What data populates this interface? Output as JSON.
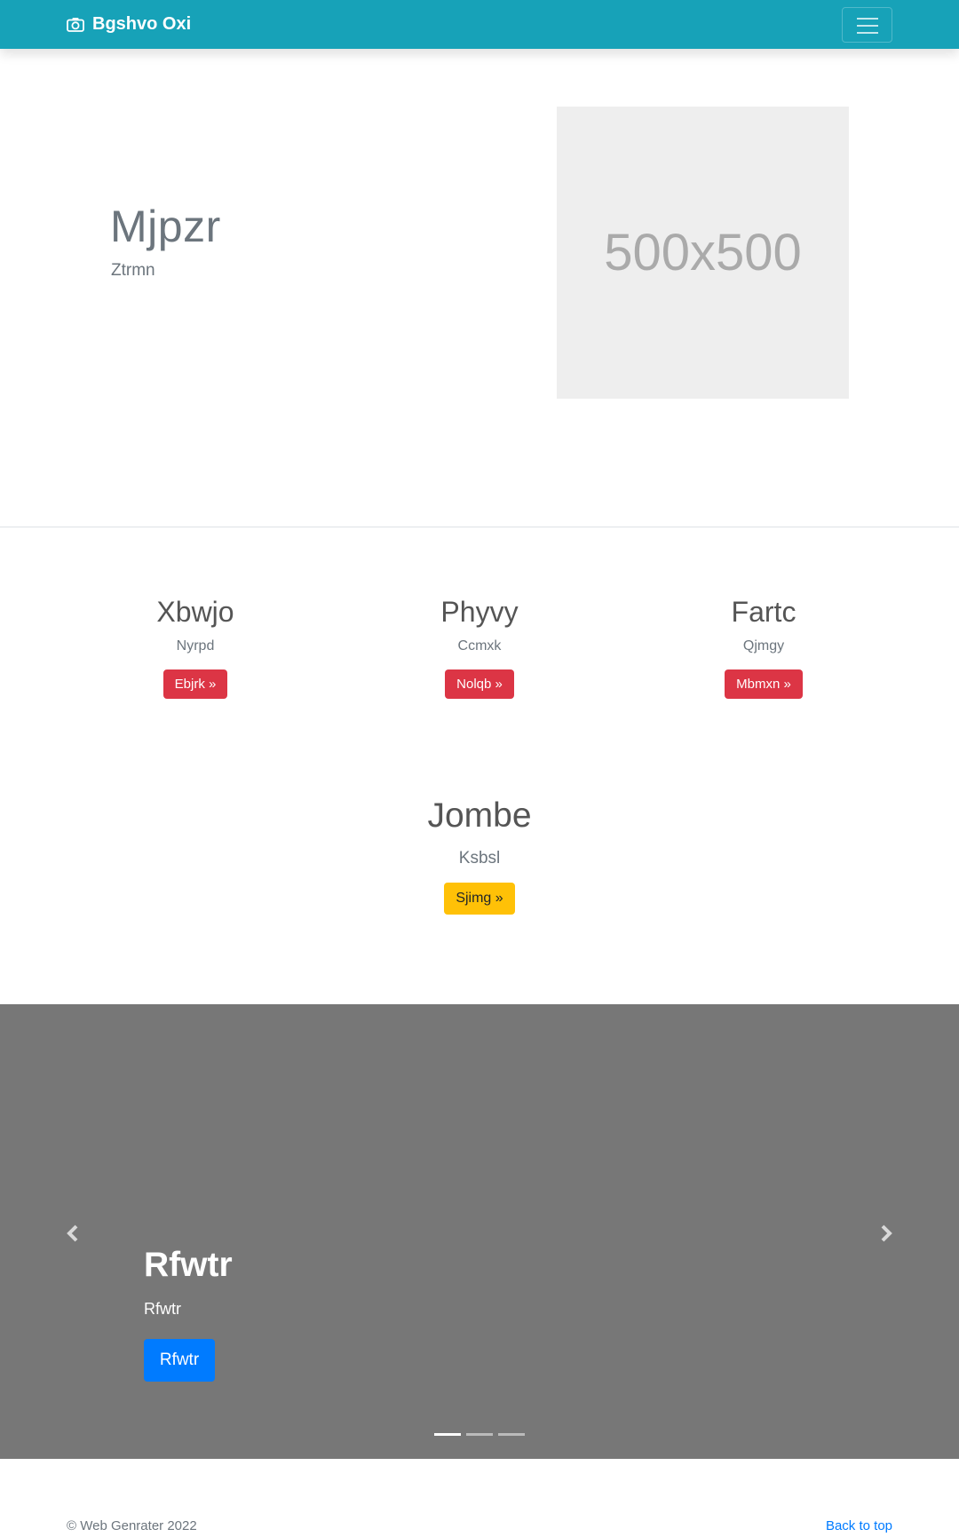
{
  "navbar": {
    "brand": "Bgshvo Oxi",
    "brand_icon": "camera-icon",
    "toggler_icon": "hamburger-icon",
    "color": "#17a2b8"
  },
  "hero": {
    "title": "Mjpzr",
    "subtitle": "Ztrmn",
    "image_label": "500x500"
  },
  "features": [
    {
      "title": "Xbwjo",
      "text": "Nyrpd",
      "button": "Ebjrk »"
    },
    {
      "title": "Phyvy",
      "text": "Ccmxk",
      "button": "Nolqb »"
    },
    {
      "title": "Fartc",
      "text": "Qjmgy",
      "button": "Mbmxn »"
    }
  ],
  "center_feature": {
    "title": "Jombe",
    "text": "Ksbsl",
    "button": "Sjimg »"
  },
  "carousel": {
    "title": "Rfwtr",
    "text": "Rfwtr",
    "button": "Rfwtr",
    "prev_icon": "chevron-left-icon",
    "next_icon": "chevron-right-icon",
    "slides": 3,
    "active_slide": 1,
    "background": "#777777"
  },
  "footer": {
    "copyright": "© Web Genrater 2022",
    "back_to_top": "Back to top"
  },
  "colors": {
    "danger": "#dc3545",
    "warning": "#ffc107",
    "primary": "#007bff"
  }
}
